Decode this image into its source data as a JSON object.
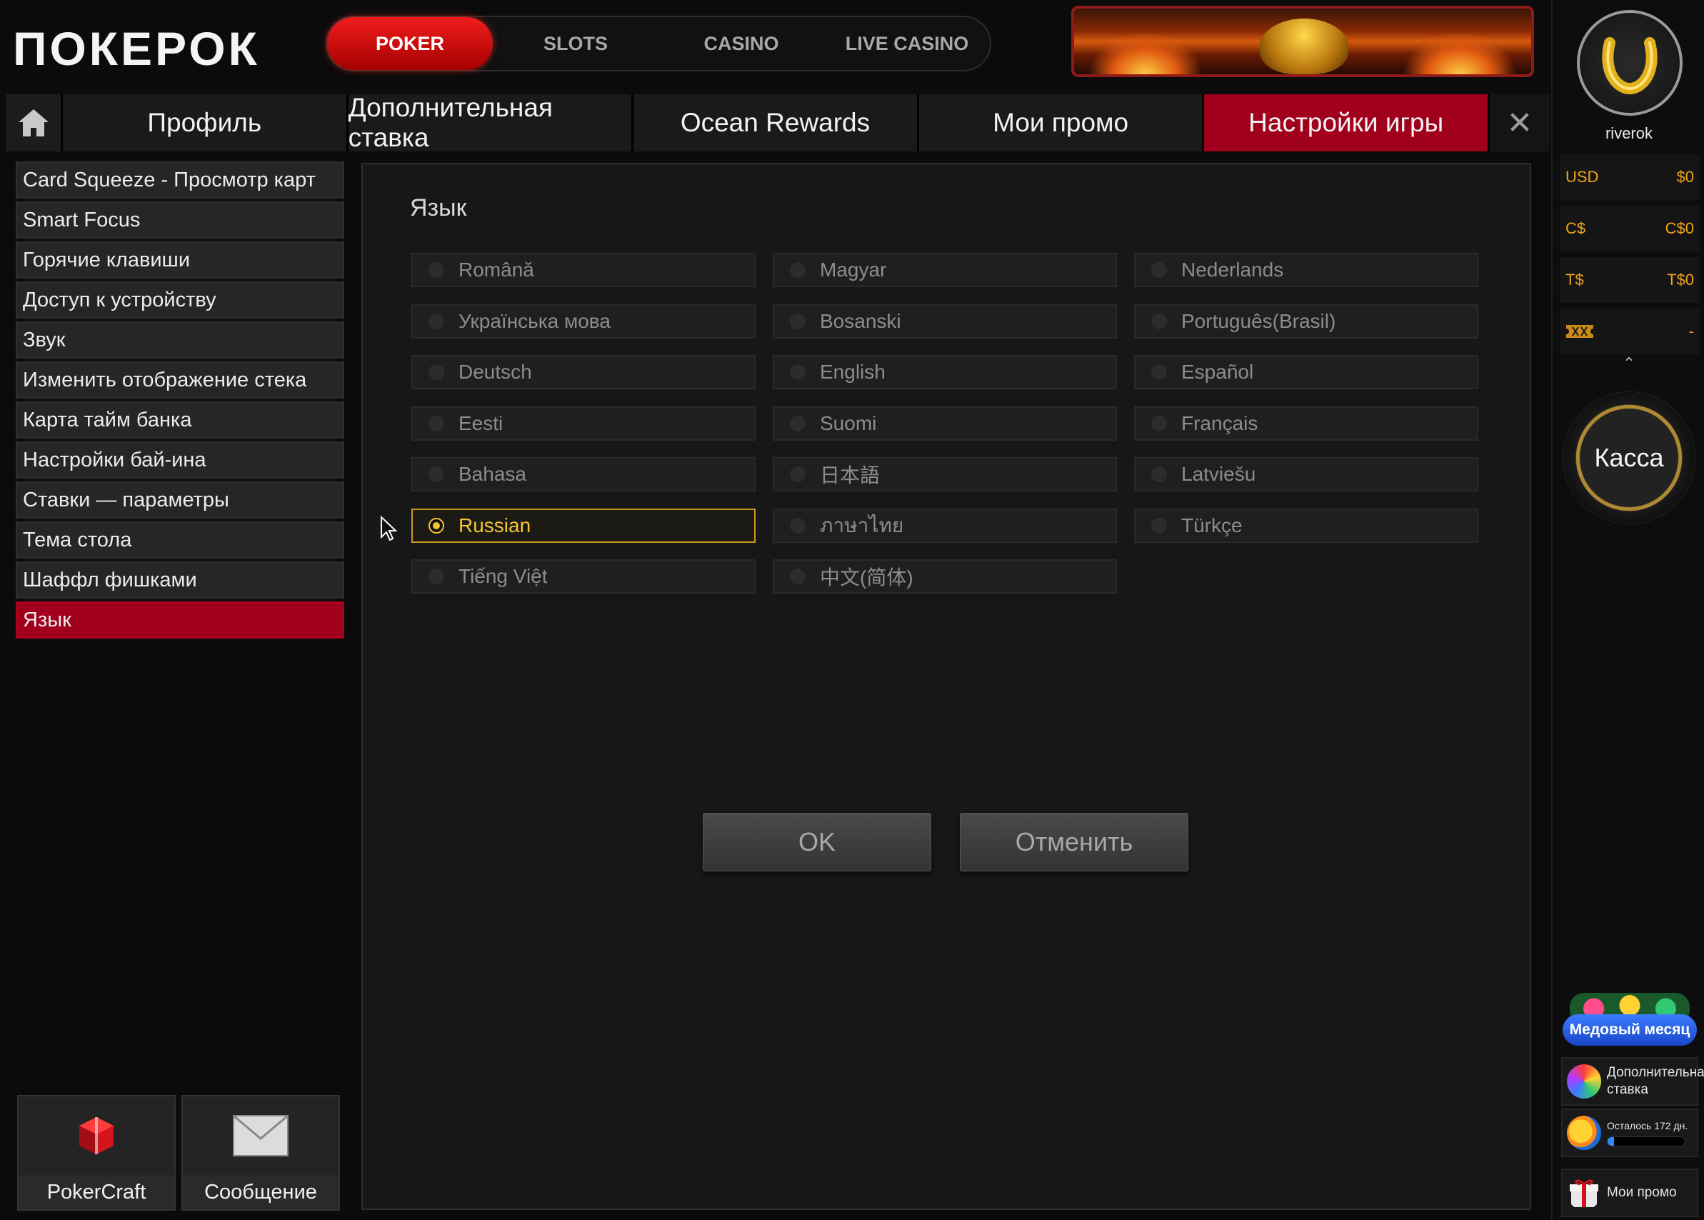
{
  "brand": {
    "logo": "ПОКЕРОК"
  },
  "top_tabs": [
    {
      "label": "POKER",
      "active": true
    },
    {
      "label": "SLOTS",
      "active": false
    },
    {
      "label": "CASINO",
      "active": false
    },
    {
      "label": "LIVE CASINO",
      "active": false
    }
  ],
  "sub_tabs": [
    {
      "label": "Профиль",
      "active": false
    },
    {
      "label": "Дополнительная ставка",
      "active": false
    },
    {
      "label": "Ocean Rewards",
      "active": false
    },
    {
      "label": "Мои промо",
      "active": false
    },
    {
      "label": "Настройки игры",
      "active": true
    }
  ],
  "left_menu": [
    {
      "label": "Card Squeeze - Просмотр карт",
      "active": false
    },
    {
      "label": "Smart Focus",
      "active": false
    },
    {
      "label": "Горячие клавиши",
      "active": false
    },
    {
      "label": "Доступ к устройству",
      "active": false
    },
    {
      "label": "Звук",
      "active": false
    },
    {
      "label": "Изменить отображение стека",
      "active": false
    },
    {
      "label": "Карта тайм банка",
      "active": false
    },
    {
      "label": "Настройки бай-ина",
      "active": false
    },
    {
      "label": "Ставки — параметры",
      "active": false
    },
    {
      "label": "Тема стола",
      "active": false
    },
    {
      "label": "Шаффл фишками",
      "active": false
    },
    {
      "label": "Язык",
      "active": true
    }
  ],
  "bottom_buttons": {
    "pokercraft": "PokerCraft",
    "message": "Сообщение"
  },
  "panel": {
    "title": "Язык",
    "languages": [
      [
        "Română",
        "Magyar",
        "Nederlands"
      ],
      [
        "Українська мова",
        "Bosanski",
        "Português(Brasil)"
      ],
      [
        "Deutsch",
        "English",
        "Español"
      ],
      [
        "Eesti",
        "Suomi",
        "Français"
      ],
      [
        "Bahasa",
        "日本語",
        "Latviešu"
      ],
      [
        "Russian",
        "ภาษาไทย",
        "Türkçe"
      ],
      [
        "Tiếng Việt",
        "中文(简体)"
      ]
    ],
    "selected": "Russian",
    "ok_label": "OK",
    "cancel_label": "Отменить"
  },
  "sidebar": {
    "username": "riverok",
    "balances": [
      {
        "currency": "USD",
        "amount": "$0"
      },
      {
        "currency": "C$",
        "amount": "C$0"
      },
      {
        "currency": "T$",
        "amount": "T$0"
      },
      {
        "currency": "",
        "amount": "-"
      }
    ],
    "kassa_label": "Касса",
    "honeymoon_label": "Медовый месяц",
    "extra_bet_label": "Дополнительная ставка",
    "days_left_label": "Осталось 172 дн.",
    "days_progress": 0.08,
    "my_promo_label": "Мои промо"
  },
  "colors": {
    "accent_red": "#a1001c",
    "poker_red": "#e41414",
    "selected_gold": "#f3c434",
    "balance_orange": "#f0a21a"
  }
}
